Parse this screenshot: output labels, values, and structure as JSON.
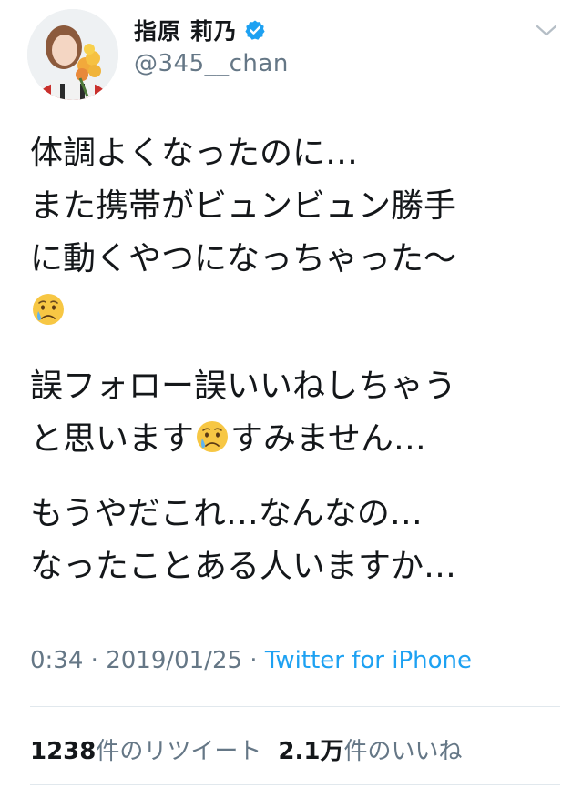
{
  "author": {
    "display_name": "指原 莉乃",
    "handle": "@345__chan",
    "verified": true,
    "verified_color": "#1da1f2"
  },
  "tweet": {
    "paragraphs": [
      {
        "lines": [
          "体調よくなったのに…",
          "また携帯がビュンビュン勝手",
          "に動くやつになっちゃった〜"
        ],
        "trailing_emoji": "crying-face-icon"
      },
      {
        "lines": [
          "誤フォロー誤いいねしちゃう",
          "と思います",
          "すみません…"
        ],
        "inline_emoji_after_line": 1
      },
      {
        "lines": [
          "もうやだこれ…なんなの…",
          "なったことある人いますか…"
        ]
      }
    ]
  },
  "meta": {
    "time": "0:34",
    "separator": " · ",
    "date": "2019/01/25",
    "separator2": " · ",
    "source": "Twitter for iPhone"
  },
  "stats": {
    "retweets_count": "1238",
    "retweets_label": "件のリツイート",
    "likes_count": "2.1万",
    "likes_label": "件のいいね"
  },
  "colors": {
    "text": "#14171a",
    "secondary": "#657786",
    "link": "#1da1f2",
    "divider": "#e1e8ed"
  }
}
